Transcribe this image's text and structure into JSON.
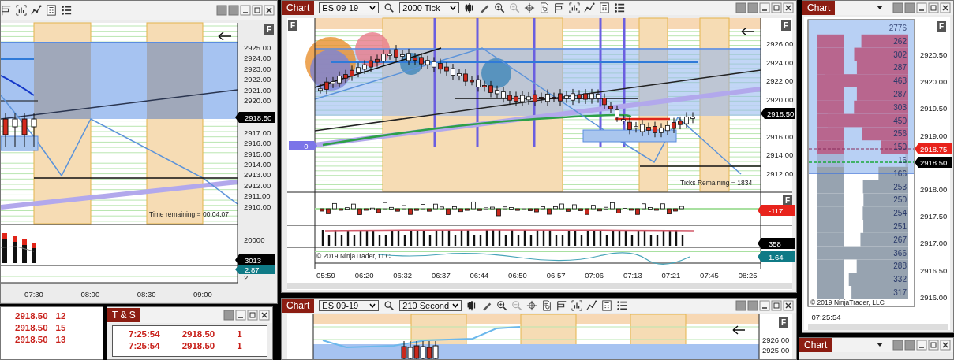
{
  "left_window": {
    "f_label": "F",
    "price_axis": [
      "2925.00",
      "2924.00",
      "2923.00",
      "2922.00",
      "2921.00",
      "2920.00",
      "2917.00",
      "2916.00",
      "2915.00",
      "2914.00",
      "2913.00",
      "2912.00",
      "2911.00",
      "2910.00"
    ],
    "last_price": "2918.50",
    "time_remaining": "Time remaining = 00:04:07",
    "volume_axis": "20000",
    "volume_label": "3013",
    "indicator_label": "2.87",
    "indicator_axis": "2",
    "time_axis": [
      "07:30",
      "08:00",
      "08:30",
      "09:00"
    ]
  },
  "ladder": {
    "rows": [
      {
        "price": "2918.50",
        "size": "12"
      },
      {
        "price": "2918.50",
        "size": "15"
      },
      {
        "price": "2918.50",
        "size": "13"
      }
    ]
  },
  "time_and_sales": {
    "tab": "T & S",
    "rows": [
      {
        "time": "7:25:54",
        "price": "2918.50",
        "size": "1"
      },
      {
        "time": "7:25:54",
        "price": "2918.50",
        "size": "1"
      }
    ]
  },
  "main_chart": {
    "tab": "Chart",
    "instrument": "ES 09-19",
    "interval": "2000 Tick",
    "f_labels": [
      "F",
      "F",
      "F"
    ],
    "price_axis": [
      "2926.00",
      "2924.00",
      "2922.00",
      "2920.00",
      "2916.00",
      "2914.00",
      "2912.00"
    ],
    "last_price": "2918.50",
    "position_label": "0",
    "ticks_remaining": "Ticks Remaining = 1834",
    "delta_label": "-117",
    "volume_label": "358",
    "indicator_label": "1.64",
    "copyright": "© 2019 NinjaTrader, LLC",
    "time_axis": [
      "05:59",
      "06:20",
      "06:32",
      "06:37",
      "06:44",
      "06:50",
      "06:57",
      "07:06",
      "07:13",
      "07:21",
      "07:45",
      "08:25"
    ]
  },
  "second_chart": {
    "tab": "Chart",
    "instrument": "ES 09-19",
    "interval": "210 Second",
    "f_label": "F",
    "price_axis": [
      "2926.00",
      "2925.00"
    ]
  },
  "dom_chart": {
    "tab": "Chart",
    "f_label": "F",
    "rows": [
      {
        "volume": "2776",
        "kind": "total"
      },
      {
        "volume": "262",
        "kind": "ask"
      },
      {
        "volume": "302",
        "kind": "ask"
      },
      {
        "volume": "287",
        "kind": "ask"
      },
      {
        "volume": "463",
        "kind": "ask"
      },
      {
        "volume": "287",
        "kind": "ask"
      },
      {
        "volume": "303",
        "kind": "ask"
      },
      {
        "volume": "450",
        "kind": "ask"
      },
      {
        "volume": "256",
        "kind": "ask"
      },
      {
        "volume": "150",
        "kind": "ask"
      },
      {
        "volume": "16",
        "kind": "last"
      },
      {
        "volume": "166",
        "kind": "bid"
      },
      {
        "volume": "253",
        "kind": "bid"
      },
      {
        "volume": "250",
        "kind": "bid"
      },
      {
        "volume": "254",
        "kind": "bid"
      },
      {
        "volume": "251",
        "kind": "bid"
      },
      {
        "volume": "267",
        "kind": "bid"
      },
      {
        "volume": "366",
        "kind": "bid"
      },
      {
        "volume": "288",
        "kind": "bid"
      },
      {
        "volume": "332",
        "kind": "bid"
      },
      {
        "volume": "317",
        "kind": "bid"
      }
    ],
    "price_axis": [
      "2920.50",
      "2920.00",
      "2919.50",
      "2919.00",
      "2918.00",
      "2917.50",
      "2917.00",
      "2916.50",
      "2916.00"
    ],
    "ask_label": "2918.75",
    "last_label": "2918.50",
    "copyright": "© 2019 NinjaTrader, LLC",
    "time": "07:25:54"
  },
  "bottom_right": {
    "tab": "Chart"
  }
}
